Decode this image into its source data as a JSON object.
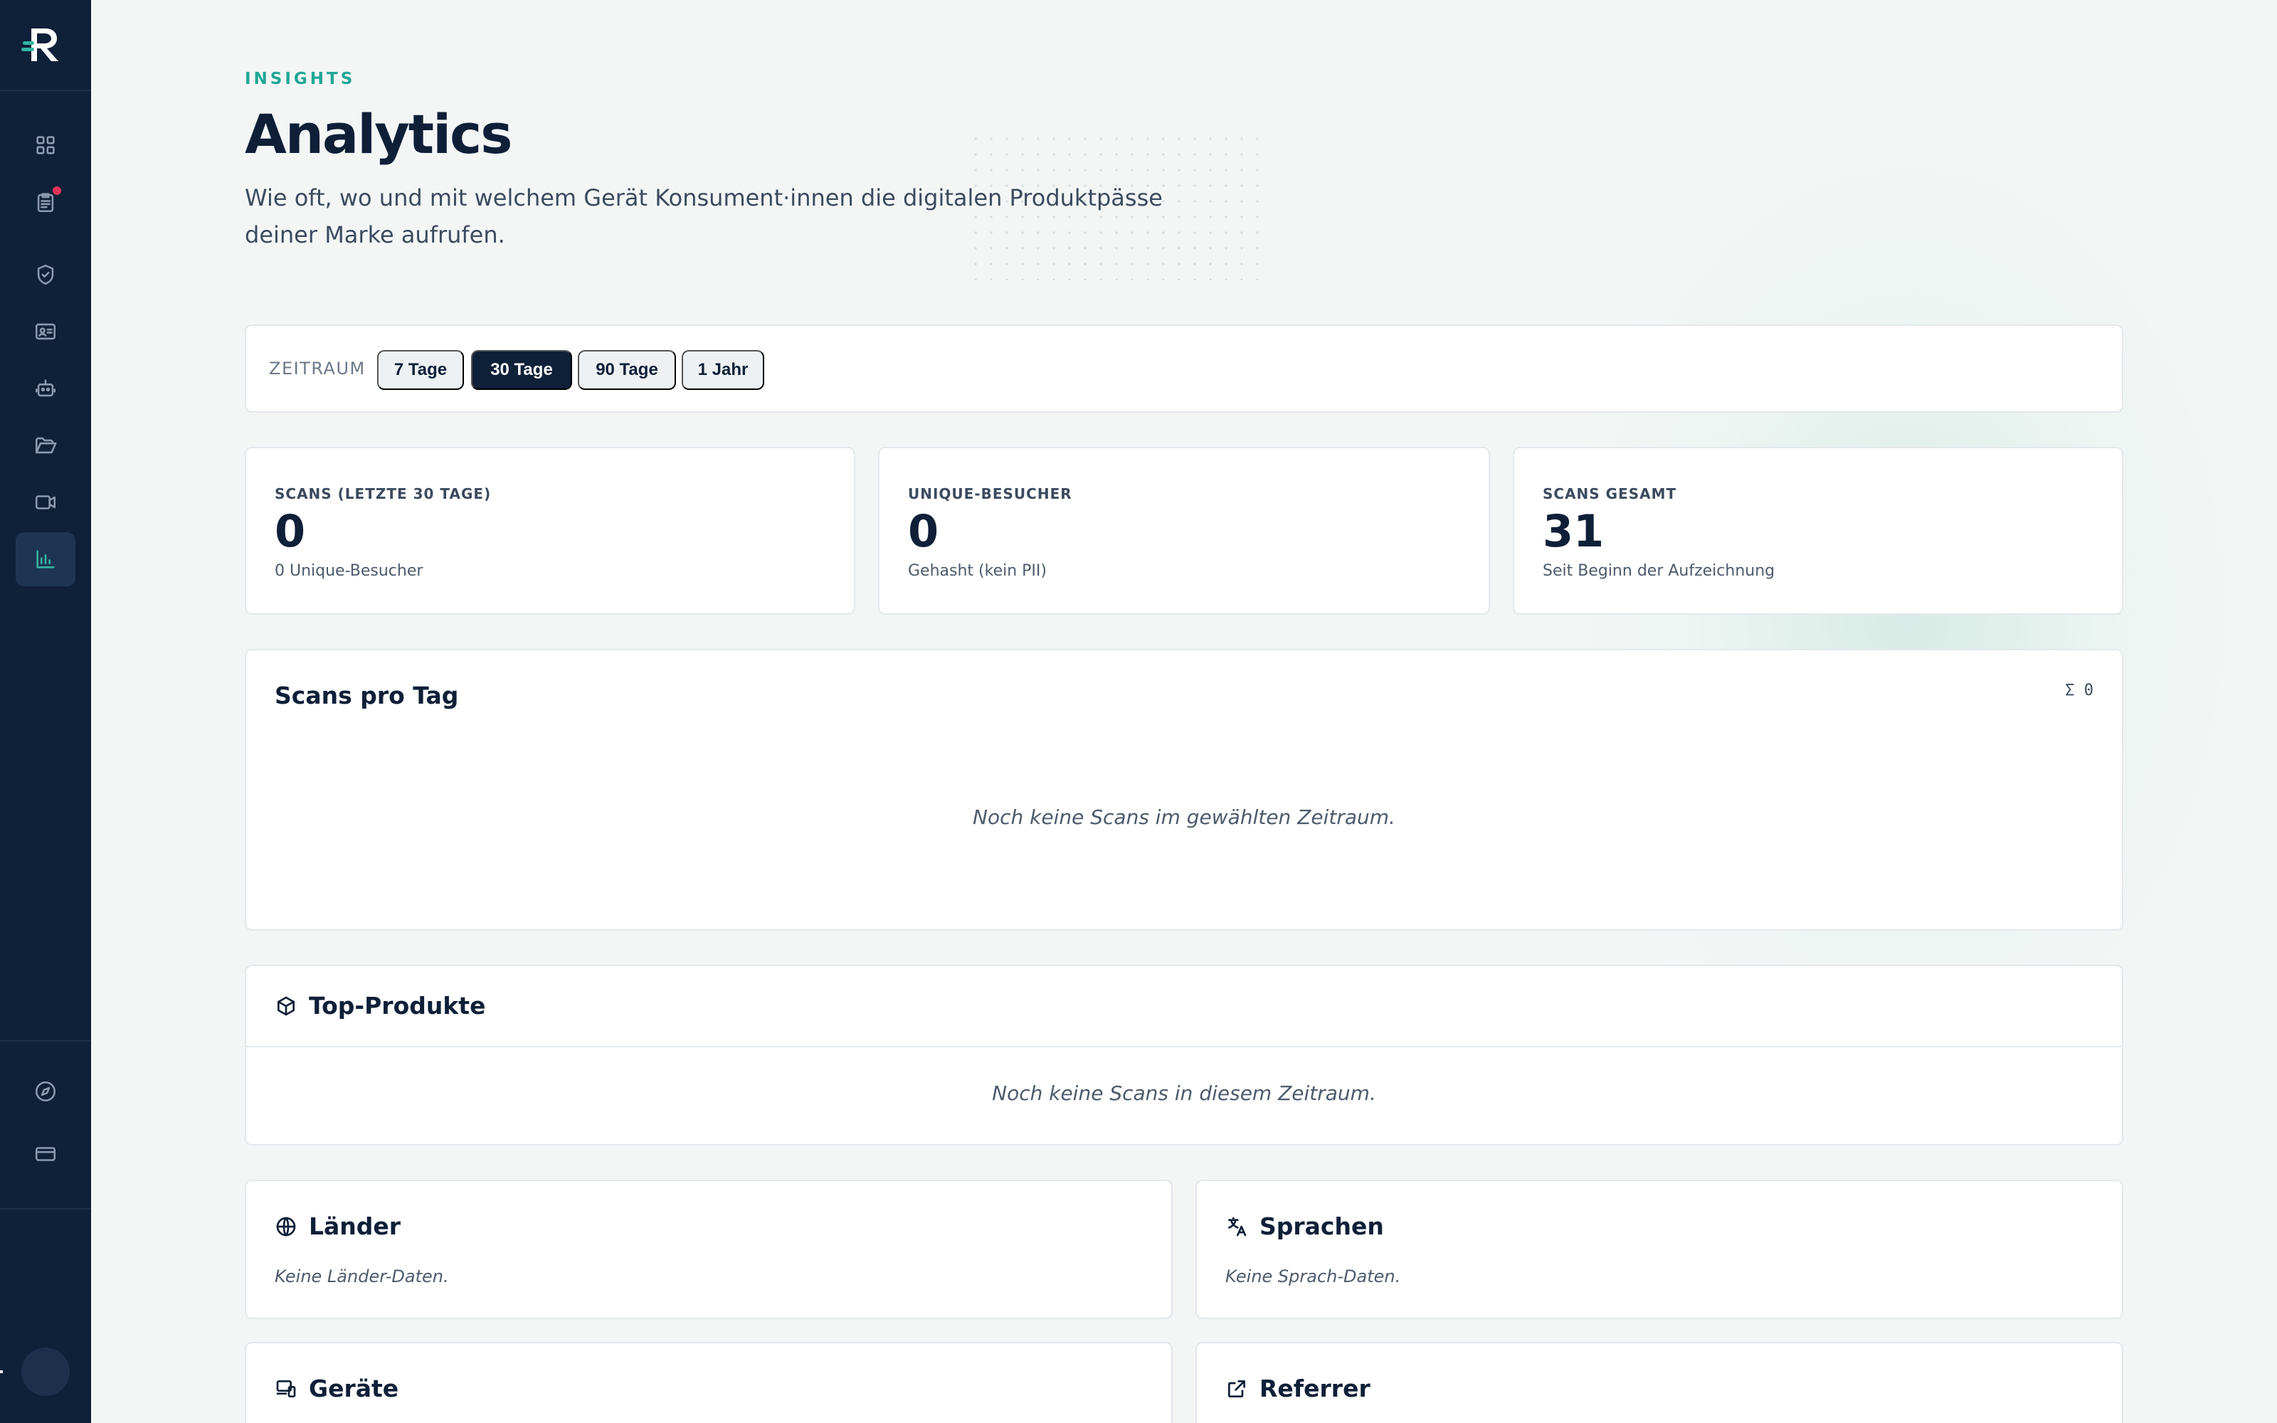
{
  "sidebar": {
    "logo": "logo-icon",
    "top_items": [
      {
        "name": "dashboard",
        "icon": "grid-icon"
      },
      {
        "name": "documents",
        "icon": "clipboard-list-icon",
        "has_notification": true
      },
      {
        "name": "compliance",
        "icon": "shield-check-icon"
      },
      {
        "name": "contacts",
        "icon": "id-card-icon"
      },
      {
        "name": "automation",
        "icon": "robot-icon"
      },
      {
        "name": "files",
        "icon": "folder-open-icon"
      },
      {
        "name": "video",
        "icon": "video-icon"
      },
      {
        "name": "analytics",
        "icon": "bar-chart-icon",
        "active": true
      }
    ],
    "bottom_items": [
      {
        "name": "explore",
        "icon": "compass-icon"
      },
      {
        "name": "billing",
        "icon": "credit-card-icon"
      }
    ],
    "colors": {
      "background": "#0f2039",
      "accent": "#34b5a3",
      "notification": "#e53558"
    }
  },
  "header": {
    "eyebrow": "INSIGHTS",
    "title": "Analytics",
    "subtitle": "Wie oft, wo und mit welchem Gerät Konsument·innen die digitalen Produktpässe deiner Marke aufrufen."
  },
  "filter": {
    "label": "ZEITRAUM",
    "options": [
      {
        "label": "7 Tage",
        "active": false
      },
      {
        "label": "30 Tage",
        "active": true
      },
      {
        "label": "90 Tage",
        "active": false
      },
      {
        "label": "1 Jahr",
        "active": false
      }
    ]
  },
  "stats": [
    {
      "label": "SCANS (LETZTE 30 TAGE)",
      "value": "0",
      "sub": "0 Unique-Besucher"
    },
    {
      "label": "UNIQUE-BESUCHER",
      "value": "0",
      "sub": "Gehasht (kein PII)"
    },
    {
      "label": "SCANS GESAMT",
      "value": "31",
      "sub": "Seit Beginn der Aufzeichnung"
    }
  ],
  "scans_per_day": {
    "title": "Scans pro Tag",
    "total": "Σ 0",
    "empty": "Noch keine Scans im gewählten Zeitraum."
  },
  "top_products": {
    "title": "Top-Produkte",
    "icon": "box-icon",
    "empty": "Noch keine Scans in diesem Zeitraum."
  },
  "countries": {
    "title": "Länder",
    "icon": "globe-icon",
    "empty": "Keine Länder-Daten."
  },
  "languages": {
    "title": "Sprachen",
    "icon": "translate-icon",
    "empty": "Keine Sprach-Daten."
  },
  "devices": {
    "title": "Geräte",
    "icon": "devices-icon"
  },
  "referrer": {
    "title": "Referrer",
    "icon": "external-link-icon"
  },
  "colors": {
    "accent": "#1fa797",
    "text": "#0f1f38",
    "card_border": "#e3e8ec"
  }
}
